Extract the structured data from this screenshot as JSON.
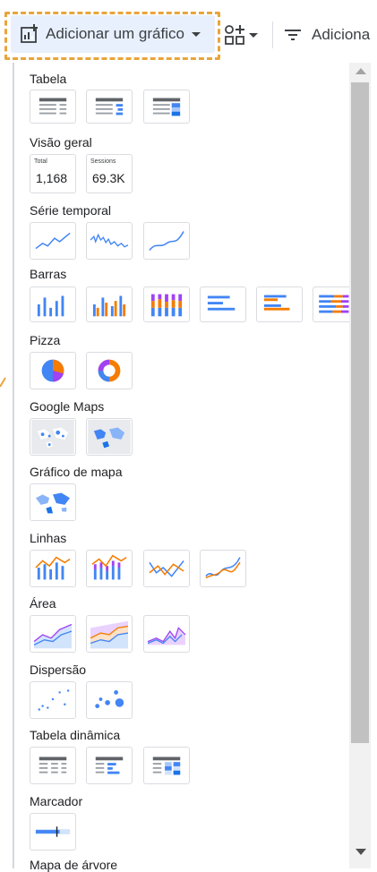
{
  "toolbar": {
    "add_chart_label": "Adicionar um gráfico",
    "add_filter_label": "Adiciona"
  },
  "sections": {
    "tabela": "Tabela",
    "visao_geral": "Visão geral",
    "serie_temporal": "Série temporal",
    "barras": "Barras",
    "pizza": "Pizza",
    "google_maps": "Google Maps",
    "grafico_mapa": "Gráfico de mapa",
    "linhas": "Linhas",
    "area": "Área",
    "dispersao": "Dispersão",
    "tabela_dinamica": "Tabela dinâmica",
    "marcador": "Marcador",
    "mapa_arvore": "Mapa de árvore"
  },
  "scorecards": [
    {
      "label": "Total",
      "value": "1,168"
    },
    {
      "label": "Sessions",
      "value": "69.3K"
    }
  ],
  "colors": {
    "accent_blue": "#4285f4",
    "orange": "#f57c00",
    "purple": "#a142f4",
    "highlight": "#e8a53b"
  }
}
